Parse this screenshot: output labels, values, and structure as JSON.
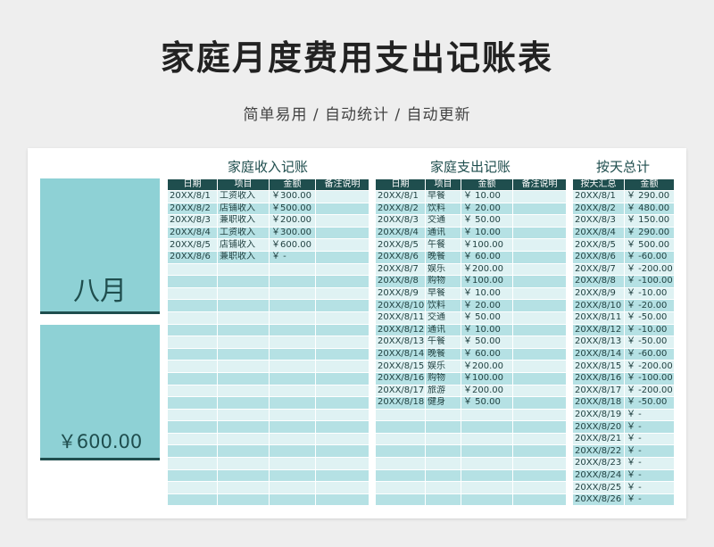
{
  "header": {
    "title": "家庭月度费用支出记账表",
    "subtitle": "简单易用 / 自动统计 / 自动更新"
  },
  "summary": {
    "month": "八月",
    "total": "￥600.00"
  },
  "income": {
    "title": "家庭收入记账",
    "columns": [
      "日期",
      "项目",
      "金额",
      "备注说明"
    ],
    "rows": [
      [
        "20XX/8/1",
        "工资收入",
        "￥300.00",
        ""
      ],
      [
        "20XX/8/2",
        "店铺收入",
        "￥500.00",
        ""
      ],
      [
        "20XX/8/3",
        "兼职收入",
        "￥200.00",
        ""
      ],
      [
        "20XX/8/4",
        "工资收入",
        "￥300.00",
        ""
      ],
      [
        "20XX/8/5",
        "店铺收入",
        "￥600.00",
        ""
      ],
      [
        "20XX/8/6",
        "兼职收入",
        "￥    -",
        ""
      ]
    ]
  },
  "expense": {
    "title": "家庭支出记账",
    "columns": [
      "日期",
      "项目",
      "金额",
      "备注说明"
    ],
    "rows": [
      [
        "20XX/8/1",
        "早餐",
        "￥  10.00",
        ""
      ],
      [
        "20XX/8/2",
        "饮料",
        "￥  20.00",
        ""
      ],
      [
        "20XX/8/3",
        "交通",
        "￥  50.00",
        ""
      ],
      [
        "20XX/8/4",
        "通讯",
        "￥  10.00",
        ""
      ],
      [
        "20XX/8/5",
        "午餐",
        "￥100.00",
        ""
      ],
      [
        "20XX/8/6",
        "晚餐",
        "￥  60.00",
        ""
      ],
      [
        "20XX/8/7",
        "娱乐",
        "￥200.00",
        ""
      ],
      [
        "20XX/8/8",
        "购物",
        "￥100.00",
        ""
      ],
      [
        "20XX/8/9",
        "早餐",
        "￥  10.00",
        ""
      ],
      [
        "20XX/8/10",
        "饮料",
        "￥  20.00",
        ""
      ],
      [
        "20XX/8/11",
        "交通",
        "￥  50.00",
        ""
      ],
      [
        "20XX/8/12",
        "通讯",
        "￥  10.00",
        ""
      ],
      [
        "20XX/8/13",
        "午餐",
        "￥  50.00",
        ""
      ],
      [
        "20XX/8/14",
        "晚餐",
        "￥  60.00",
        ""
      ],
      [
        "20XX/8/15",
        "娱乐",
        "￥200.00",
        ""
      ],
      [
        "20XX/8/16",
        "购物",
        "￥100.00",
        ""
      ],
      [
        "20XX/8/17",
        "旅游",
        "￥200.00",
        ""
      ],
      [
        "20XX/8/18",
        "健身",
        "￥  50.00",
        ""
      ]
    ]
  },
  "daily": {
    "title": "按天总计",
    "columns": [
      "按天汇总",
      "金额"
    ],
    "rows": [
      [
        "20XX/8/1",
        "￥ 290.00"
      ],
      [
        "20XX/8/2",
        "￥ 480.00"
      ],
      [
        "20XX/8/3",
        "￥ 150.00"
      ],
      [
        "20XX/8/4",
        "￥ 290.00"
      ],
      [
        "20XX/8/5",
        "￥ 500.00"
      ],
      [
        "20XX/8/6",
        "￥  -60.00"
      ],
      [
        "20XX/8/7",
        "￥ -200.00"
      ],
      [
        "20XX/8/8",
        "￥ -100.00"
      ],
      [
        "20XX/8/9",
        "￥  -10.00"
      ],
      [
        "20XX/8/10",
        "￥  -20.00"
      ],
      [
        "20XX/8/11",
        "￥  -50.00"
      ],
      [
        "20XX/8/12",
        "￥  -10.00"
      ],
      [
        "20XX/8/13",
        "￥  -50.00"
      ],
      [
        "20XX/8/14",
        "￥  -60.00"
      ],
      [
        "20XX/8/15",
        "￥ -200.00"
      ],
      [
        "20XX/8/16",
        "￥ -100.00"
      ],
      [
        "20XX/8/17",
        "￥ -200.00"
      ],
      [
        "20XX/8/18",
        "￥  -50.00"
      ],
      [
        "20XX/8/19",
        "￥      -"
      ],
      [
        "20XX/8/20",
        "￥      -"
      ],
      [
        "20XX/8/21",
        "￥      -"
      ],
      [
        "20XX/8/22",
        "￥      -"
      ],
      [
        "20XX/8/23",
        "￥      -"
      ],
      [
        "20XX/8/24",
        "￥      -"
      ],
      [
        "20XX/8/25",
        "￥      -"
      ],
      [
        "20XX/8/26",
        "￥      -"
      ]
    ]
  }
}
